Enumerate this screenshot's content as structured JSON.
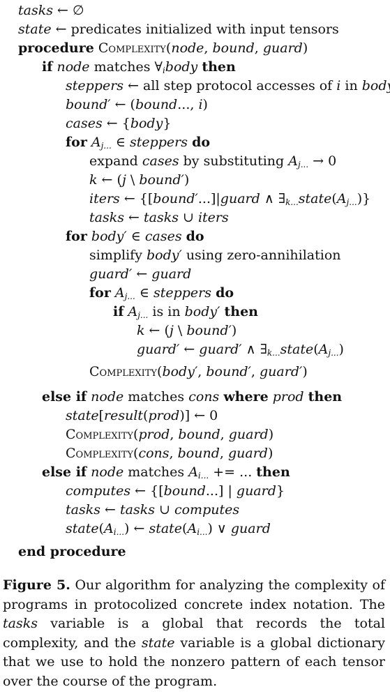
{
  "algorithm": {
    "lines": [
      {
        "indent": 0,
        "html": "<span class='i'>tasks</span> ← ∅"
      },
      {
        "indent": 0,
        "html": "<span class='i'>state</span> ← predicates initialized with input tensors"
      },
      {
        "indent": 0,
        "html": "<span class='b'>procedure</span> <span class='sc'>Complexity</span>(<span class='i'>node</span>, <span class='i'>bound</span>, <span class='i'>guard</span>)"
      },
      {
        "indent": 1,
        "html": "<span class='b'>if</span> <span class='i'>node</span> matches ∀<sub class='i'>i</sub><span class='i'>body</span> <span class='b'>then</span>"
      },
      {
        "indent": 2,
        "html": "<span class='i'>steppers</span> ← all step protocol accesses of <span class='i'>i</span> in <span class='i'>body</span>"
      },
      {
        "indent": 2,
        "html": "<span class='i'>bound′</span> ← (<span class='i'>bound</span>..., <span class='i'>i</span>)"
      },
      {
        "indent": 2,
        "html": "<span class='i'>cases</span> ← {<span class='i'>body</span>}"
      },
      {
        "indent": 2,
        "html": "<span class='b'>for</span> <span class='i'>A</span><sub class='i'>j...</sub> ∈ <span class='i'>steppers</span> <span class='b'>do</span>"
      },
      {
        "indent": 3,
        "html": "expand <span class='i'>cases</span> by substituting <span class='i'>A</span><sub class='i'>j...</sub> → 0"
      },
      {
        "indent": 3,
        "html": "<span class='i'>k</span> ← (<span class='i'>j</span> \\ <span class='i'>bound′</span>)"
      },
      {
        "indent": 3,
        "html": "<span class='i'>iters</span> ← {[<span class='i'>bound′</span>...]|<span class='i'>guard</span> ∧ ∃<sub class='i'>k...</sub><span class='i'>state</span>(<span class='i'>A</span><sub class='i'>j...</sub>)}"
      },
      {
        "indent": 3,
        "html": "<span class='i'>tasks</span> ← <span class='i'>tasks</span> ∪ <span class='i'>iters</span>"
      },
      {
        "indent": 2,
        "html": "<span class='b'>for</span> <span class='i'>body′</span> ∈ <span class='i'>cases</span> <span class='b'>do</span>"
      },
      {
        "indent": 3,
        "html": "simplify <span class='i'>body′</span> using zero-annihilation"
      },
      {
        "indent": 3,
        "html": "<span class='i'>guard′</span> ← <span class='i'>guard</span>"
      },
      {
        "indent": 3,
        "html": "<span class='b'>for</span> <span class='i'>A</span><sub class='i'>j...</sub> ∈ <span class='i'>steppers</span> <span class='b'>do</span>"
      },
      {
        "indent": 4,
        "html": "<span class='b'>if</span> <span class='i'>A</span><sub class='i'>j...</sub> is in <span class='i'>body′</span> <span class='b'>then</span>"
      },
      {
        "indent": 5,
        "html": "<span class='i'>k</span> ← (<span class='i'>j</span> \\ <span class='i'>bound′</span>)"
      },
      {
        "indent": 5,
        "html": "<span class='i'>guard′</span> ← <span class='i'>guard′</span> ∧ ∃<sub class='i'>k...</sub><span class='i'>state</span>(<span class='i'>A</span><sub class='i'>j...</sub>)"
      },
      {
        "indent": 3,
        "html": "<span class='sc'>Complexity</span>(<span class='i'>body′</span>, <span class='i'>bound′</span>, <span class='i'>guard′</span>)"
      },
      {
        "indent": 1,
        "html": "<span class='b'>else if</span> <span class='i'>node</span> matches <span class='i'>cons</span> <span class='b'>where</span> <span class='i'>prod</span> <span class='b'>then</span>"
      },
      {
        "indent": 2,
        "html": "<span class='i'>state</span>[<span class='i'>result</span>(<span class='i'>prod</span>)] ← 0"
      },
      {
        "indent": 2,
        "html": "<span class='sc'>Complexity</span>(<span class='i'>prod</span>, <span class='i'>bound</span>, <span class='i'>guard</span>)"
      },
      {
        "indent": 2,
        "html": "<span class='sc'>Complexity</span>(<span class='i'>cons</span>, <span class='i'>bound</span>, <span class='i'>guard</span>)"
      },
      {
        "indent": 1,
        "html": "<span class='b'>else if</span> <span class='i'>node</span> matches <span class='i'>A</span><sub class='i'>i...</sub> += ... <span class='b'>then</span>"
      },
      {
        "indent": 2,
        "html": "<span class='i'>computes</span> ← {[<span class='i'>bound</span>...] | <span class='i'>guard</span>}"
      },
      {
        "indent": 2,
        "html": "<span class='i'>tasks</span> ← <span class='i'>tasks</span> ∪ <span class='i'>computes</span>"
      },
      {
        "indent": 2,
        "html": "<span class='i'>state</span>(<span class='i'>A</span><sub class='i'>i...</sub>) ← <span class='i'>state</span>(<span class='i'>A</span><sub class='i'>i...</sub>) ∨ <span class='i'>guard</span>"
      },
      {
        "indent": 0,
        "html": "<span class='b'>end procedure</span>"
      }
    ]
  },
  "caption": {
    "label": "Figure 5.",
    "html": "Our algorithm for analyzing the complexity of programs in protocolized concrete index notation. The <span class='i'>tasks</span> variable is a global that records the total complexity, and the <span class='i'>state</span> variable is a global dictionary that we use to hold the nonzero pattern of each tensor over the course of the program."
  }
}
